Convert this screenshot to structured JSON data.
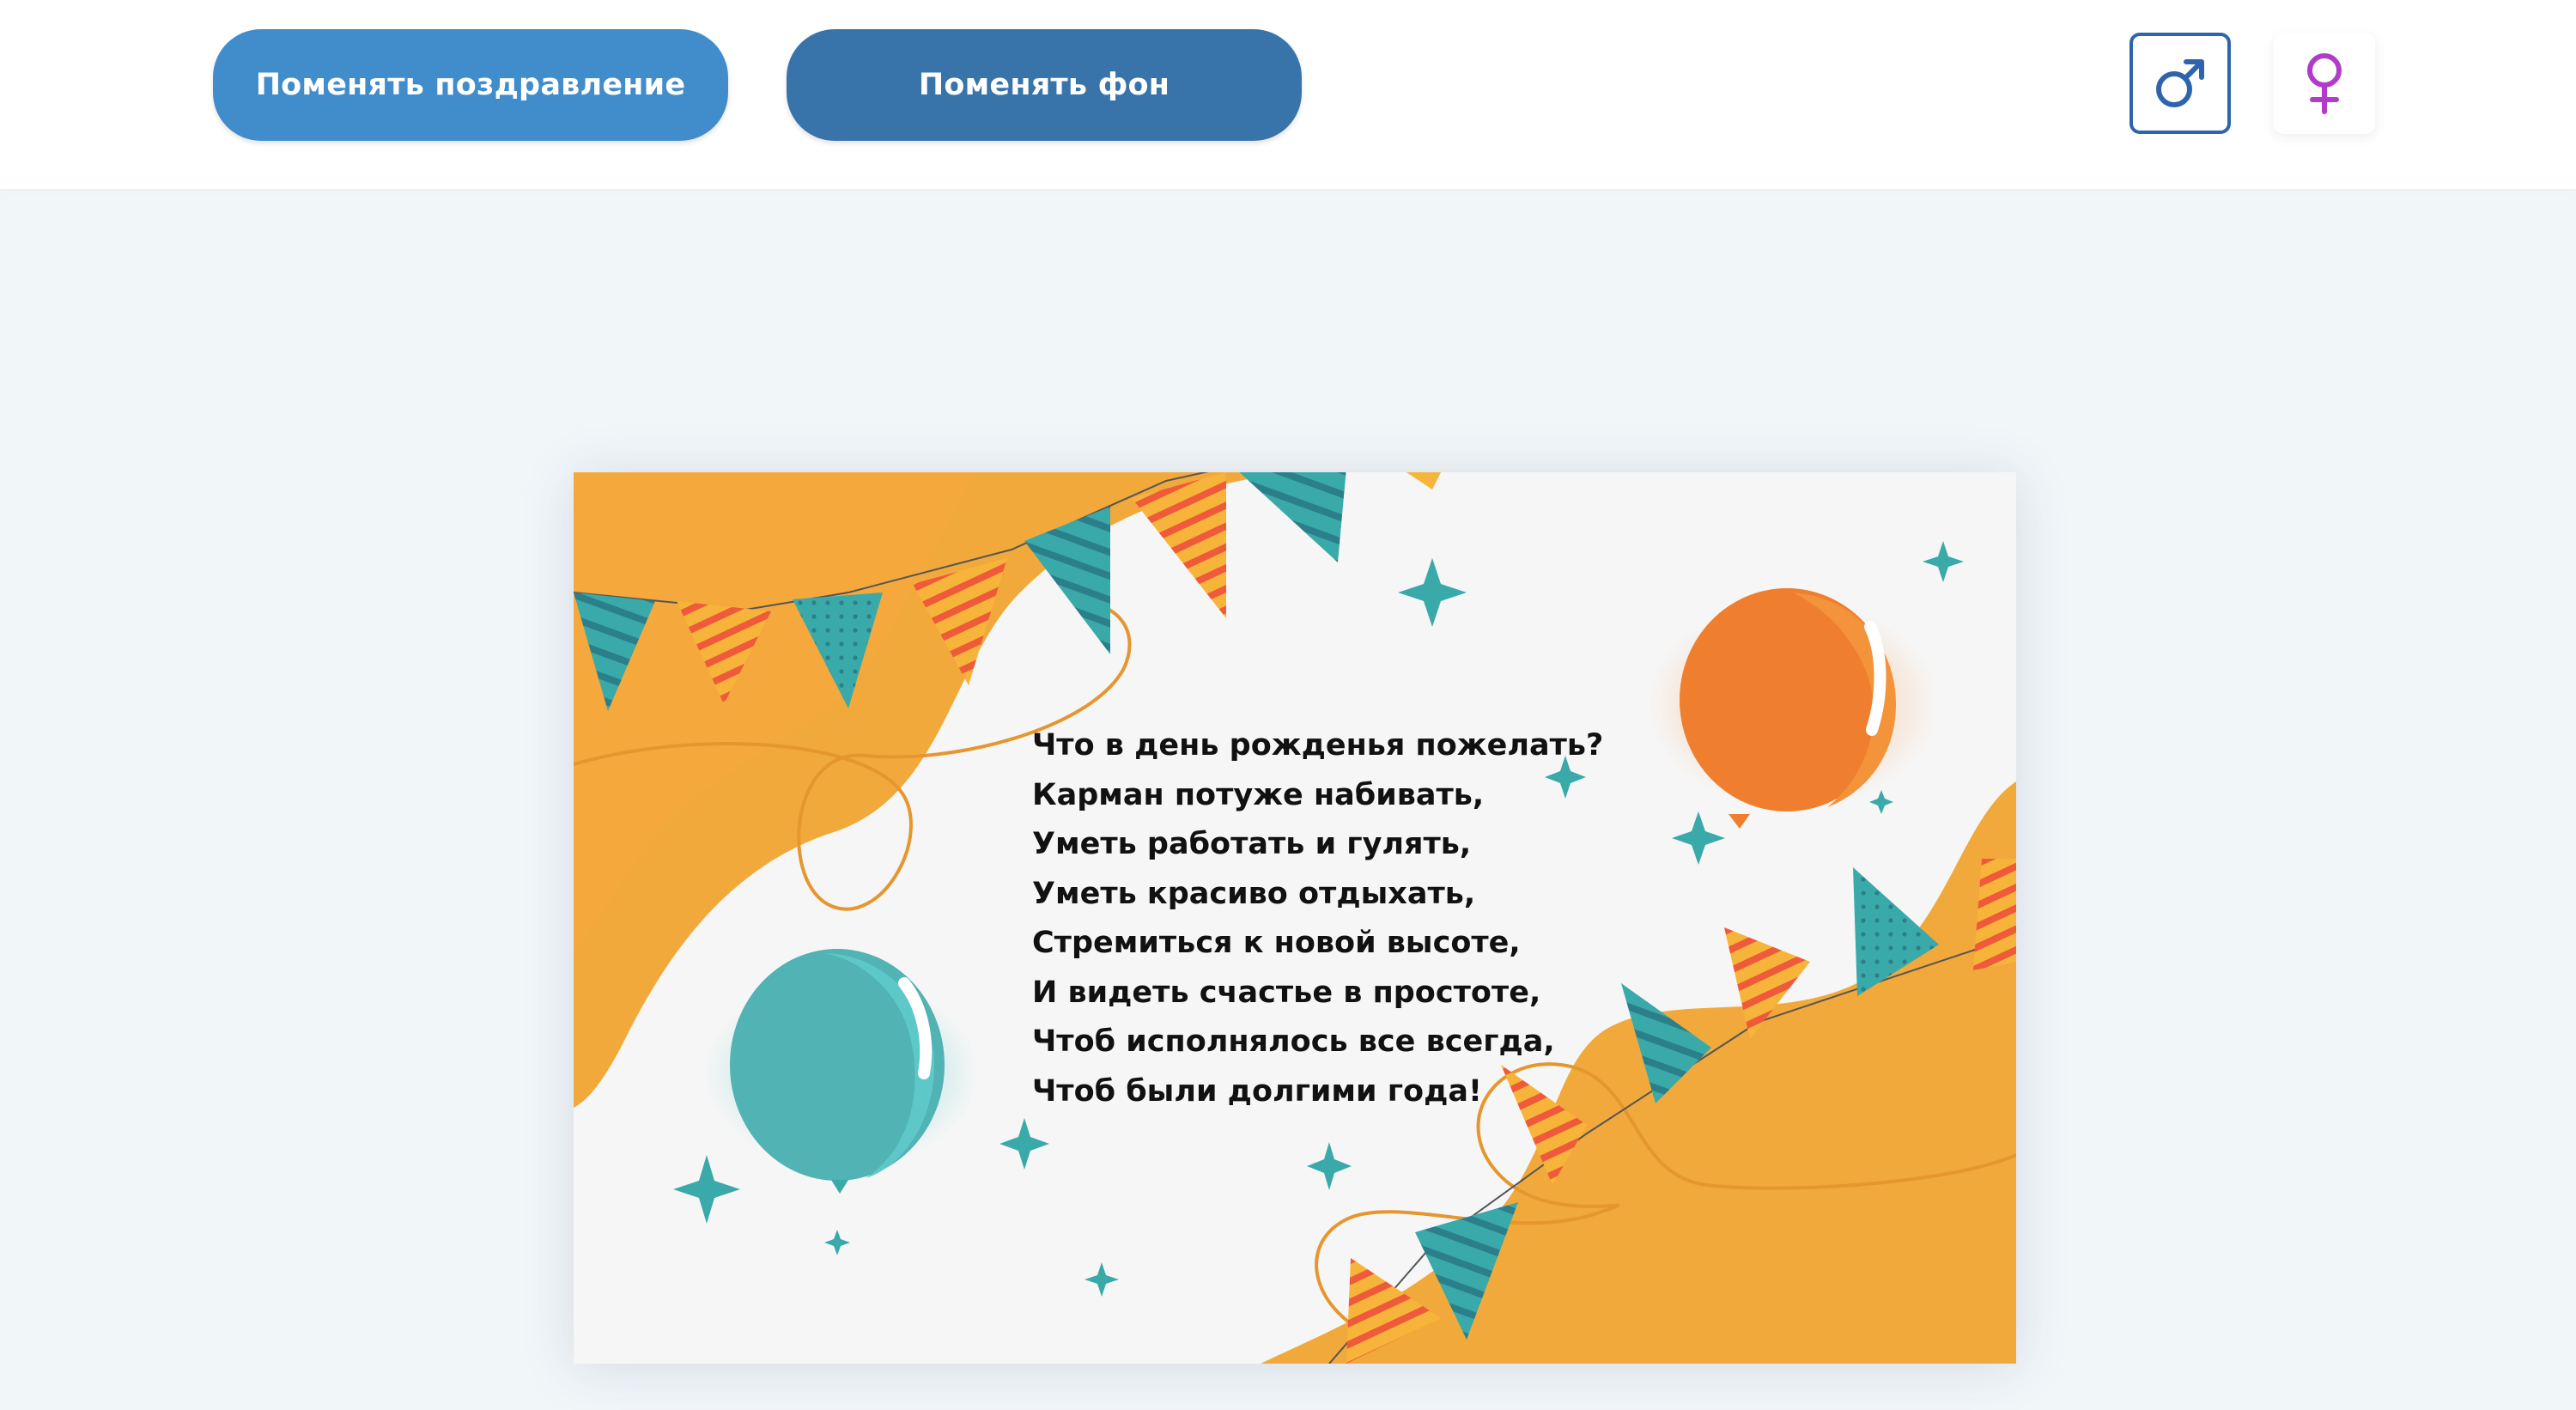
{
  "toolbar": {
    "change_greeting_label": "Поменять поздравление",
    "change_background_label": "Поменять фон",
    "male_icon": "male-symbol-icon",
    "female_icon": "female-symbol-icon"
  },
  "card": {
    "lines": [
      "Что в день рожденья пожелать?",
      "Карман потуже набивать,",
      "Уметь работать и гулять,",
      "Уметь красиво отдыхать,",
      "Стремиться к новой высоте,",
      "И видеть счастье в простоте,",
      "Чтоб исполнялось все всегда,",
      "Чтоб были долгими года!"
    ]
  },
  "colors": {
    "button_primary": "#418cca",
    "button_secondary": "#3874aa",
    "male_accent": "#2f64ad",
    "female_accent": "#b03cc8",
    "card_orange": "#f2a93b",
    "card_teal": "#3aa9a9"
  }
}
